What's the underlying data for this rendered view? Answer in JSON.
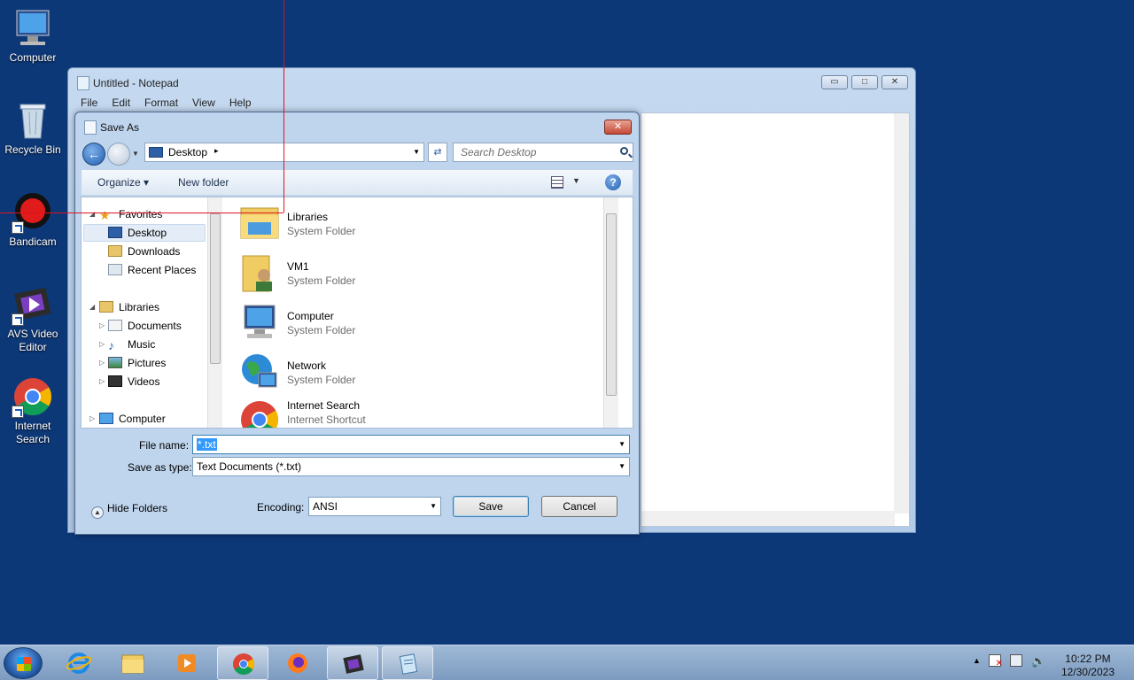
{
  "desktop_icons": [
    {
      "label": "Computer",
      "icon": "computer-icon"
    },
    {
      "label": "Recycle Bin",
      "icon": "recycle-bin-icon"
    },
    {
      "label": "Bandicam",
      "icon": "bandicam-icon"
    },
    {
      "label": "AVS Video Editor",
      "icon": "video-editor-icon"
    },
    {
      "label": "Internet Search",
      "icon": "chrome-icon"
    }
  ],
  "notepad": {
    "title": "Untitled - Notepad",
    "menu": [
      "File",
      "Edit",
      "Format",
      "View",
      "Help"
    ],
    "buttons": {
      "minimize": "▭",
      "maximize": "□",
      "close": "✕"
    }
  },
  "dialog": {
    "title": "Save As",
    "close": "✕",
    "address": {
      "location": "Desktop",
      "arrow": "▸"
    },
    "search_placeholder": "Search Desktop",
    "toolbar": {
      "organize": "Organize ▾",
      "new_folder": "New folder",
      "help": "?"
    },
    "tree": {
      "favorites": "Favorites",
      "desktop": "Desktop",
      "downloads": "Downloads",
      "recent": "Recent Places",
      "libraries": "Libraries",
      "documents": "Documents",
      "music": "Music",
      "pictures": "Pictures",
      "videos": "Videos",
      "computer": "Computer"
    },
    "files": [
      {
        "name": "Libraries",
        "type": "System Folder"
      },
      {
        "name": "VM1",
        "type": "System Folder"
      },
      {
        "name": "Computer",
        "type": "System Folder"
      },
      {
        "name": "Network",
        "type": "System Folder"
      },
      {
        "name": "Internet Search",
        "type": "Internet Shortcut"
      }
    ],
    "filename_label": "File name:",
    "filename_value": "*.txt",
    "savetype_label": "Save as type:",
    "savetype_value": "Text Documents (*.txt)",
    "hide_folders": "Hide Folders",
    "encoding_label": "Encoding:",
    "encoding_value": "ANSI",
    "save_button": "Save",
    "cancel_button": "Cancel"
  },
  "taskbar": {
    "time": "10:22 PM",
    "date": "12/30/2023"
  }
}
